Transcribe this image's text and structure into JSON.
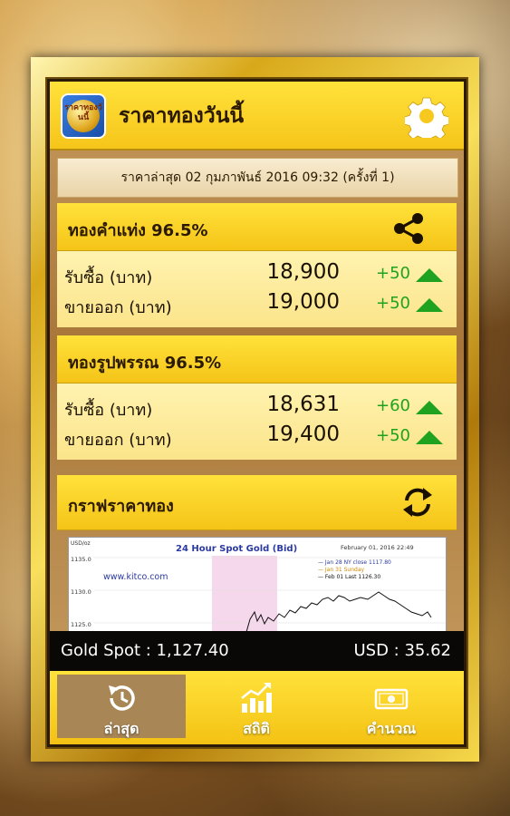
{
  "header": {
    "app_title": "ราคาทองวันนี้",
    "logo_text": "ราคาทองวันนี้",
    "settings_icon": "gear-icon"
  },
  "updated": {
    "text": "ราคาล่าสุด 02 กุมภาพันธ์ 2016  09:32 (ครั้งที่ 1)"
  },
  "gold_bar": {
    "title": "ทองคำแท่ง 96.5%",
    "share_icon": "share-icon",
    "rows": [
      {
        "label": "รับซื้อ (บาท)",
        "value": "18,900",
        "change": "+50",
        "trend": "up"
      },
      {
        "label": "ขายออก (บาท)",
        "value": "19,000",
        "change": "+50",
        "trend": "up"
      }
    ]
  },
  "gold_ornament": {
    "title": "ทองรูปพรรณ 96.5%",
    "rows": [
      {
        "label": "รับซื้อ (บาท)",
        "value": "18,631",
        "change": "+60",
        "trend": "up"
      },
      {
        "label": "ขายออก (บาท)",
        "value": "19,400",
        "change": "+50",
        "trend": "up"
      }
    ]
  },
  "graph": {
    "title": "กราฟราคาทอง",
    "refresh_icon": "refresh-icon",
    "chart_title": "24 Hour Spot Gold (Bid)",
    "chart_date": "February 01, 2016 22:49",
    "watermark": "www.kitco.com",
    "y_unit": "USD/oz",
    "y_ticks": [
      "1135.0",
      "1130.0",
      "1125.0"
    ],
    "legend": [
      "— Jan 28 NY close 1117.80",
      "— Jan 31 Sunday",
      "— Feb 01 Last 1126.30"
    ]
  },
  "spot": {
    "gold_spot": "Gold Spot :  1,127.40",
    "usd": "USD : 35.62"
  },
  "tabs": [
    {
      "label": "ล่าสุด",
      "icon": "history-icon",
      "active": true
    },
    {
      "label": "สถิติ",
      "icon": "chart-icon",
      "active": false
    },
    {
      "label": "คำนวณ",
      "icon": "money-icon",
      "active": false
    }
  ],
  "colors": {
    "accent_yellow": "#ffe23a",
    "up_green": "#1fa21f"
  }
}
